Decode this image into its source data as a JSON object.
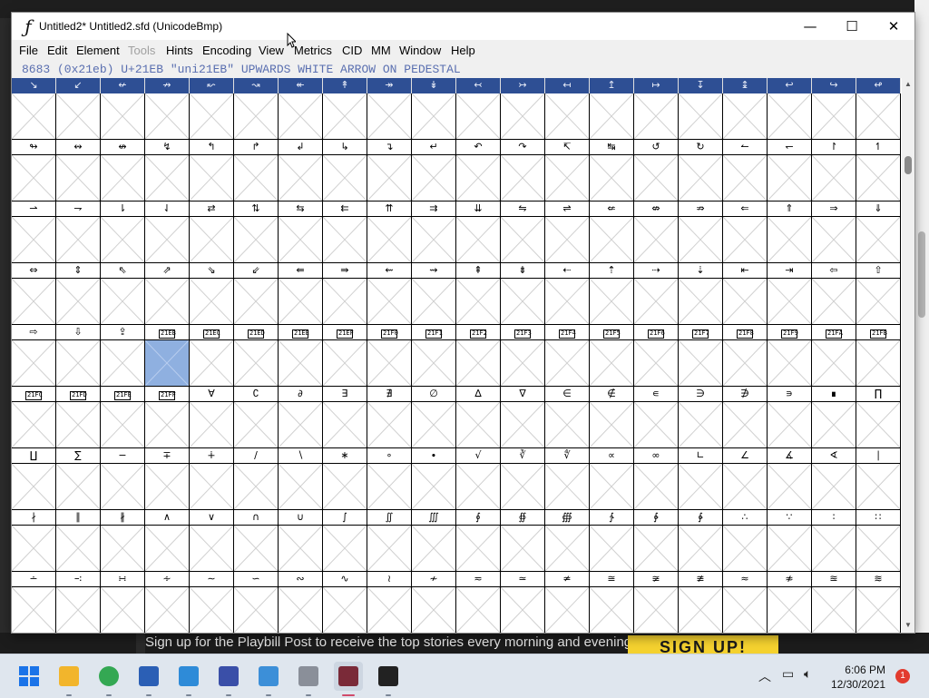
{
  "background": {
    "banner_text": "Sign up for the Playbill Post to receive the top stories every morning and evening.",
    "banner_button": "SIGN UP!"
  },
  "window": {
    "title": "Untitled2*  Untitled2.sfd (UnicodeBmp)",
    "minimize": "—",
    "maximize": "☐",
    "close": "✕"
  },
  "menu": [
    {
      "label": "File",
      "enabled": true
    },
    {
      "label": "Edit",
      "enabled": true
    },
    {
      "label": "Element",
      "enabled": true
    },
    {
      "label": "Tools",
      "enabled": false
    },
    {
      "label": "Hints",
      "enabled": true
    },
    {
      "label": "Encoding",
      "enabled": true
    },
    {
      "label": "View",
      "enabled": true
    },
    {
      "label": "Metrics",
      "enabled": true
    },
    {
      "label": "CID",
      "enabled": true
    },
    {
      "label": "MM",
      "enabled": true
    },
    {
      "label": "Window",
      "enabled": true
    },
    {
      "label": "Help",
      "enabled": true
    }
  ],
  "info_line": "8683 (0x21eb) U+21EB \"uni21EB\" UPWARDS WHITE ARROW ON PEDESTAL",
  "glyph_rows": [
    [
      "↘",
      "↙",
      "↚",
      "↛",
      "↜",
      "↝",
      "↞",
      "↟",
      "↠",
      "↡",
      "↢",
      "↣",
      "↤",
      "↥",
      "↦",
      "↧",
      "↨",
      "↩",
      "↪",
      "↫"
    ],
    [
      "↬",
      "↭",
      "↮",
      "↯",
      "↰",
      "↱",
      "↲",
      "↳",
      "↴",
      "↵",
      "↶",
      "↷",
      "↸",
      "↹",
      "↺",
      "↻",
      "↼",
      "↽",
      "↾",
      "↿"
    ],
    [
      "⇀",
      "⇁",
      "⇂",
      "⇃",
      "⇄",
      "⇅",
      "⇆",
      "⇇",
      "⇈",
      "⇉",
      "⇊",
      "⇋",
      "⇌",
      "⇍",
      "⇎",
      "⇏",
      "⇐",
      "⇑",
      "⇒",
      "⇓"
    ],
    [
      "⇔",
      "⇕",
      "⇖",
      "⇗",
      "⇘",
      "⇙",
      "⇚",
      "⇛",
      "⇜",
      "⇝",
      "⇞",
      "⇟",
      "⇠",
      "⇡",
      "⇢",
      "⇣",
      "⇤",
      "⇥",
      "⇦",
      "⇧"
    ],
    [
      "⇨",
      "⇩",
      "⇪",
      "21EB",
      "21EC",
      "21ED",
      "21EE",
      "21EF",
      "21F0",
      "21F1",
      "21F2",
      "21F3",
      "21F4",
      "21F5",
      "21F6",
      "21F7",
      "21F8",
      "21F9",
      "21FA",
      "21FB"
    ],
    [
      "21FC",
      "21FD",
      "21FE",
      "21FF",
      "∀",
      "∁",
      "∂",
      "∃",
      "∄",
      "∅",
      "∆",
      "∇",
      "∈",
      "∉",
      "∊",
      "∋",
      "∌",
      "∍",
      "∎",
      "∏"
    ],
    [
      "∐",
      "∑",
      "−",
      "∓",
      "∔",
      "∕",
      "∖",
      "∗",
      "∘",
      "∙",
      "√",
      "∛",
      "∜",
      "∝",
      "∞",
      "∟",
      "∠",
      "∡",
      "∢",
      "∣"
    ],
    [
      "∤",
      "∥",
      "∦",
      "∧",
      "∨",
      "∩",
      "∪",
      "∫",
      "∬",
      "∭",
      "∮",
      "∯",
      "∰",
      "∱",
      "∲",
      "∳",
      "∴",
      "∵",
      "∶",
      "∷"
    ],
    [
      "∸",
      "∹",
      "∺",
      "∻",
      "∼",
      "∽",
      "∾",
      "∿",
      "≀",
      "≁",
      "≂",
      "≃",
      "≄",
      "≅",
      "≆",
      "≇",
      "≈",
      "≉",
      "≊",
      "≋"
    ]
  ],
  "selected": {
    "row": 4,
    "col": 3
  },
  "taskbar": {
    "apps": [
      {
        "name": "start-icon",
        "color": "#1a73e8"
      },
      {
        "name": "file-explorer-icon",
        "color": "#f2b52c"
      },
      {
        "name": "chrome-icon",
        "color": "#34a853"
      },
      {
        "name": "store-icon",
        "color": "#2b5fb5"
      },
      {
        "name": "network-app-icon",
        "color": "#2e8bd8"
      },
      {
        "name": "inkscape-icon",
        "color": "#3a4fa8"
      },
      {
        "name": "notepad-icon",
        "color": "#3c8fd8"
      },
      {
        "name": "box-app-icon",
        "color": "#8a8f99"
      },
      {
        "name": "fontforge-icon",
        "color": "#7a2a38"
      },
      {
        "name": "terminal-icon",
        "color": "#222222"
      }
    ],
    "time": "6:06 PM",
    "date": "12/30/2021",
    "notifications": "1"
  }
}
